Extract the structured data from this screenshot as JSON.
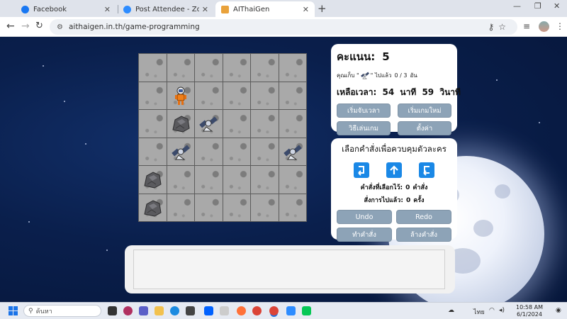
{
  "browser": {
    "tabs": [
      {
        "title": "Facebook",
        "favicon_color": "#1877f2",
        "active": false
      },
      {
        "title": "Post Attendee - Zoom",
        "favicon_color": "#2d8cff",
        "active": false
      },
      {
        "title": "AIThaiGen",
        "favicon_color": "#e9a23b",
        "active": true
      }
    ],
    "url": "aithaigen.in.th/game-programming"
  },
  "game": {
    "board": [
      [
        "empty",
        "empty",
        "empty",
        "empty",
        "empty",
        "empty"
      ],
      [
        "empty",
        "astronaut",
        "empty",
        "empty",
        "empty",
        "empty"
      ],
      [
        "empty",
        "rock",
        "satellite",
        "empty",
        "empty",
        "empty"
      ],
      [
        "empty",
        "satellite",
        "empty",
        "empty",
        "empty",
        "satellite"
      ],
      [
        "rock",
        "empty",
        "empty",
        "empty",
        "empty",
        "empty"
      ],
      [
        "rock",
        "empty",
        "empty",
        "empty",
        "empty",
        "empty"
      ]
    ],
    "score": {
      "label": "คะแนน:",
      "value": "5"
    },
    "collect": {
      "prefix": "คุณเก็บ \"",
      "suffix": "\" ไปแล้ว",
      "count": "0 / 3",
      "unit": "อัน"
    },
    "time": {
      "label": "เหลือเวลา:",
      "minutes": "54",
      "minutes_unit": "นาที",
      "seconds": "59",
      "seconds_unit": "วินาที"
    },
    "buttons": {
      "start_timer": "เริ่มจับเวลา",
      "new_game": "เริ่มเกมใหม่",
      "how_to_play": "วิธีเล่นเกม",
      "settings": "ตั้งค่า"
    },
    "commands": {
      "title": "เลือกคำสั่งเพื่อควบคุมตัวละคร",
      "selected_label": "คำสั่งที่เลือกไว้:",
      "selected_count": "0",
      "selected_unit": "คำสั่ง",
      "executed_label": "สั่งการไปแล้ว:",
      "executed_count": "0",
      "executed_unit": "ครั้ง",
      "undo": "Undo",
      "redo": "Redo",
      "run": "ทำคำสั่ง",
      "clear": "ล้างคำสั่ง"
    }
  },
  "taskbar": {
    "search_placeholder": "ค้นหา",
    "lang": "ไทย",
    "time": "10:58 AM",
    "date": "6/1/2024"
  }
}
